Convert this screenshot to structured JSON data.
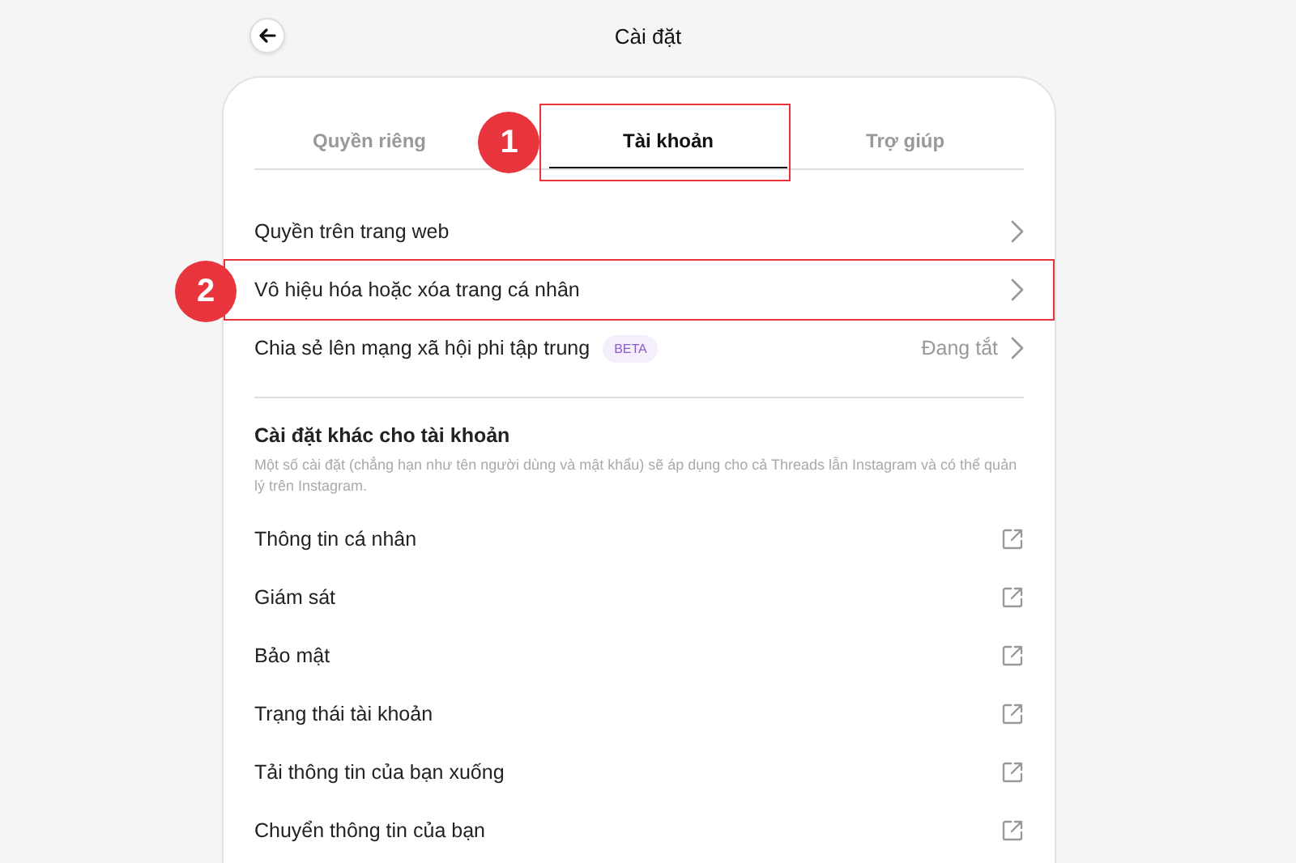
{
  "header": {
    "title": "Cài đặt"
  },
  "tabs": [
    {
      "label": "Quyền riêng",
      "selected": false
    },
    {
      "label": "Tài khoản",
      "selected": true,
      "callout": "1"
    },
    {
      "label": "Trợ giúp",
      "selected": false
    }
  ],
  "rows": [
    {
      "label": "Quyền trên trang web"
    },
    {
      "label": "Vô hiệu hóa hoặc xóa trang cá nhân",
      "callout": "2"
    },
    {
      "label": "Chia sẻ lên mạng xã hội phi tập trung",
      "badge": "BETA",
      "value": "Đang tắt"
    }
  ],
  "section": {
    "title": "Cài đặt khác cho tài khoản",
    "description": "Một số cài đặt (chẳng hạn như tên người dùng và mật khẩu) sẽ áp dụng cho cả Threads lẫn Instagram và có thể quản lý trên Instagram.",
    "links": [
      {
        "label": "Thông tin cá nhân"
      },
      {
        "label": "Giám sát"
      },
      {
        "label": "Bảo mật"
      },
      {
        "label": "Trạng thái tài khoản"
      },
      {
        "label": "Tải thông tin của bạn xuống"
      },
      {
        "label": "Chuyển thông tin của bạn"
      }
    ]
  }
}
